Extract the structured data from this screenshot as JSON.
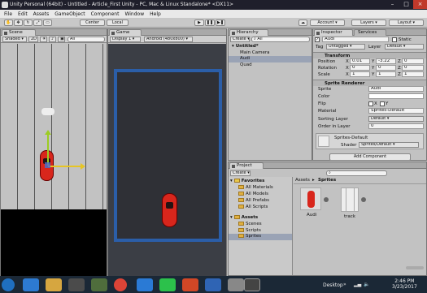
{
  "window": {
    "title": "Unity Personal (64bit) - Untitled - Article_First Unity - PC, Mac & Linux Standalone* <DX11>"
  },
  "menu": [
    "File",
    "Edit",
    "Assets",
    "GameObject",
    "Component",
    "Window",
    "Help"
  ],
  "toolbar": {
    "pivot": "Center",
    "space": "Local",
    "account": "Account",
    "layers": "Layers",
    "layout": "Layout"
  },
  "scene": {
    "tab": "Scene",
    "shading": "Shaded",
    "mode2d": "2D",
    "gizmos": "Gizmos",
    "search_placeholder": "All"
  },
  "game": {
    "tab": "Game",
    "display": "Display 1",
    "aspect": "Android (480x800)"
  },
  "hierarchy": {
    "tab": "Hierarchy",
    "create": "Create",
    "search_placeholder": "All",
    "scene_name": "Untitled*",
    "items": [
      "Main Camera",
      "Audi",
      "Quad"
    ]
  },
  "inspector": {
    "tab": "Inspector",
    "services_tab": "Services",
    "object_name": "Audi",
    "static_label": "Static",
    "tag_label": "Tag",
    "tag_value": "Untagged",
    "layer_label": "Layer",
    "layer_value": "Default",
    "transform": {
      "title": "Transform",
      "position": {
        "label": "Position",
        "x": "0.01",
        "y": "-3.22",
        "z": "0"
      },
      "rotation": {
        "label": "Rotation",
        "x": "0",
        "y": "0",
        "z": "0"
      },
      "scale": {
        "label": "Scale",
        "x": "1",
        "y": "1",
        "z": "1"
      }
    },
    "sprite_renderer": {
      "title": "Sprite Renderer",
      "sprite_label": "Sprite",
      "sprite_value": "Audi",
      "color_label": "Color",
      "flip_label": "Flip",
      "flip_x": "X",
      "flip_y": "Y",
      "material_label": "Material",
      "material_value": "Sprites-Default",
      "sorting_layer_label": "Sorting Layer",
      "sorting_layer_value": "Default",
      "order_label": "Order in Layer",
      "order_value": "0"
    },
    "material": {
      "name": "Sprites-Default",
      "shader_label": "Shader",
      "shader_value": "Sprites/Default"
    },
    "add_component": "Add Component"
  },
  "project": {
    "tab": "Project",
    "create": "Create",
    "favorites": {
      "title": "Favorites",
      "items": [
        "All Materials",
        "All Models",
        "All Prefabs",
        "All Scripts"
      ]
    },
    "assets": {
      "title": "Assets",
      "items": [
        "Scenes",
        "Scripts",
        "Sprites"
      ]
    },
    "breadcrumb": {
      "root": "Assets",
      "sep": "▸",
      "current": "Sprites"
    },
    "grid_items": [
      "Audi",
      "track"
    ]
  },
  "taskbar": {
    "desktop_label": "Desktop",
    "time": "2:46 PM",
    "date": "3/23/2017"
  },
  "colors": {
    "game_border": "#2b5ea8",
    "car_red": "#d8261c",
    "selection": "#9aa3b5"
  }
}
